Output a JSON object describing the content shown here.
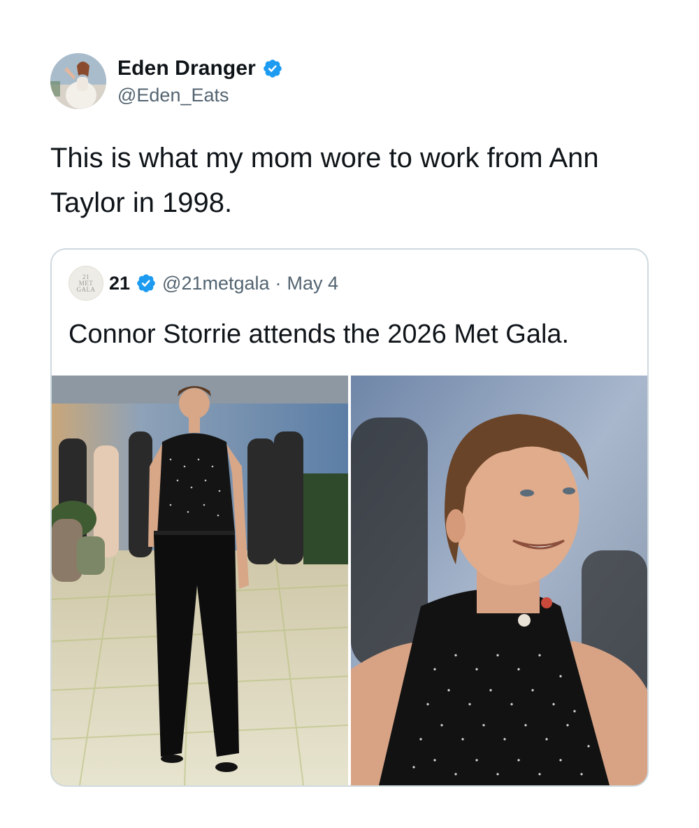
{
  "tweet": {
    "author": {
      "display_name": "Eden Dranger",
      "handle": "@Eden_Eats",
      "verified": true,
      "avatar_icon": "profile-photo"
    },
    "text": "This is what my mom wore to work from Ann Taylor in 1998."
  },
  "quoted_tweet": {
    "author": {
      "display_name": "21",
      "handle": "@21metgala",
      "verified": true,
      "avatar_logo_lines": [
        "21",
        "MET",
        "GALA"
      ]
    },
    "separator": "·",
    "date": "May 4",
    "text": "Connor Storrie attends the 2026 Met Gala.",
    "media": [
      {
        "kind": "photo",
        "subject": "full-length-photo"
      },
      {
        "kind": "photo",
        "subject": "close-up-photo"
      }
    ]
  },
  "colors": {
    "text_primary": "#0f1419",
    "text_secondary": "#536471",
    "verified_blue": "#1d9bf0",
    "border": "#cfd9de"
  }
}
